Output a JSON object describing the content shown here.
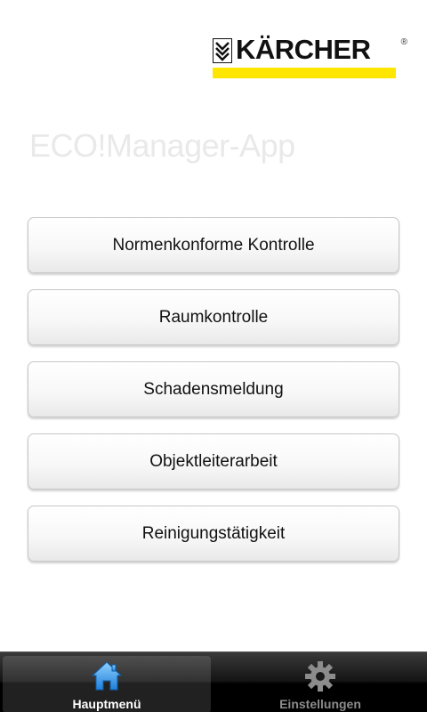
{
  "logo": {
    "text": "KÄRCHER",
    "registered": "®",
    "stripe_color": "#ffe600"
  },
  "app_title": "ECO!Manager-App",
  "menu": [
    {
      "label": "Normenkonforme Kontrolle"
    },
    {
      "label": "Raumkontrolle"
    },
    {
      "label": "Schadensmeldung"
    },
    {
      "label": "Objektleiterarbeit"
    },
    {
      "label": "Reinigungstätigkeit"
    }
  ],
  "tabbar": {
    "tabs": [
      {
        "label": "Hauptmenü",
        "icon": "home-icon",
        "active": true
      },
      {
        "label": "Einstellungen",
        "icon": "gear-icon",
        "active": false
      }
    ]
  }
}
